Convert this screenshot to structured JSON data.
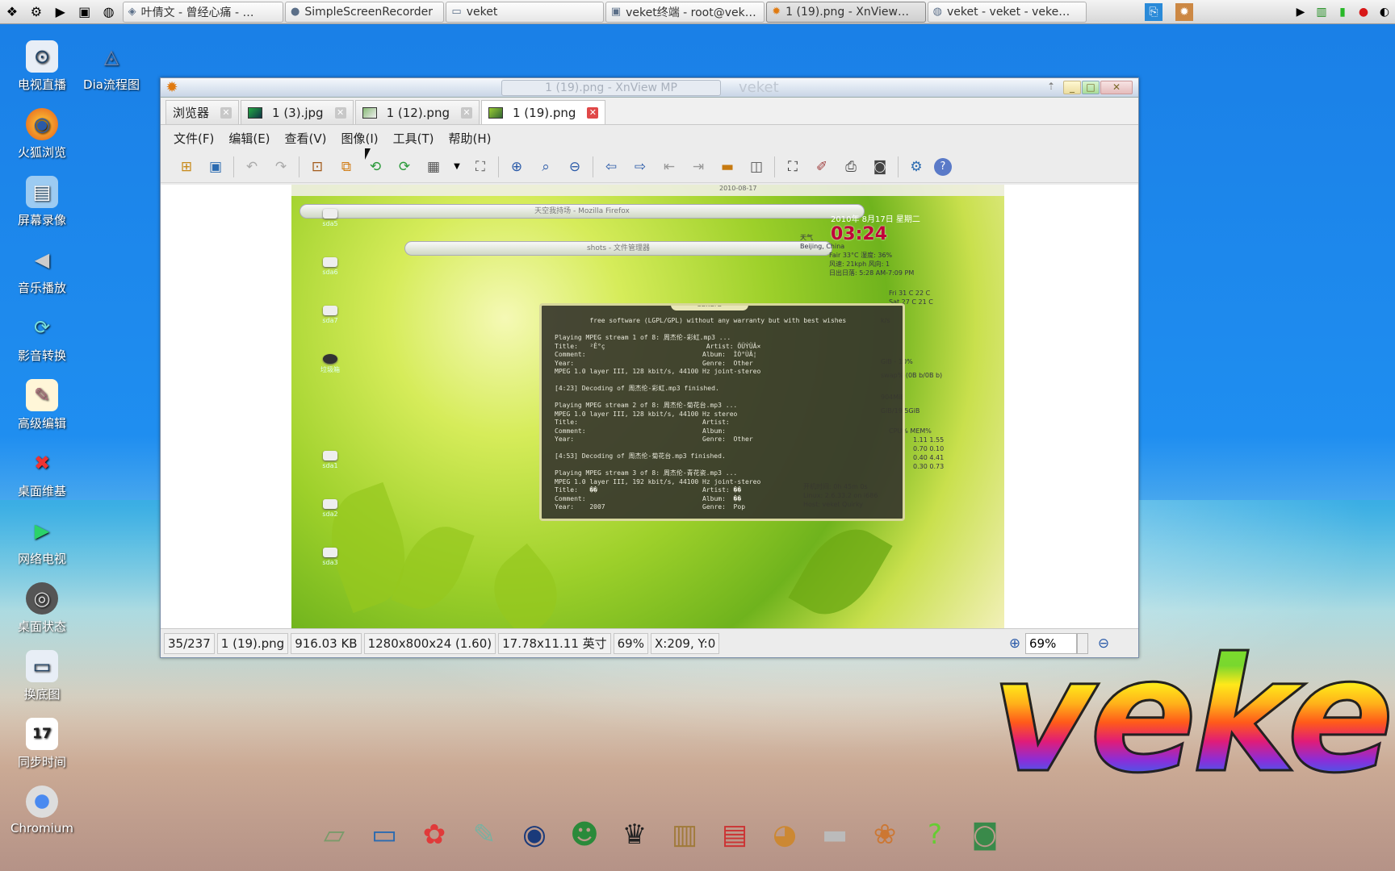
{
  "taskbar": {
    "tasks": [
      {
        "label": "叶倩文 - 曾经心痛 - …",
        "icon": "music-player-icon",
        "active": false
      },
      {
        "label": "SimpleScreenRecorder",
        "icon": "screen-recorder-icon",
        "active": false
      },
      {
        "label": "veket",
        "icon": "folder-icon",
        "active": false
      },
      {
        "label": "veket终端 - root@vek…",
        "icon": "terminal-icon",
        "active": false
      },
      {
        "label": "1 (19).png - XnView…",
        "icon": "xnview-icon",
        "active": true
      },
      {
        "label": "veket - veket - veke…",
        "icon": "browser-icon",
        "active": false
      }
    ]
  },
  "desktop": {
    "icons": [
      {
        "label": "电视直播",
        "icon": "tv-icon"
      },
      {
        "label": "Dia流程图",
        "icon": "dia-icon"
      },
      {
        "label": "火狐浏览",
        "icon": "firefox-icon"
      },
      {
        "label": "屏幕录像",
        "icon": "screen-record-icon"
      },
      {
        "label": "音乐播放",
        "icon": "speaker-icon"
      },
      {
        "label": "影音转换",
        "icon": "media-convert-icon"
      },
      {
        "label": "高级编辑",
        "icon": "editor-icon"
      },
      {
        "label": "桌面维基",
        "icon": "wiki-icon"
      },
      {
        "label": "网络电视",
        "icon": "play-icon"
      },
      {
        "label": "桌面状态",
        "icon": "status-icon"
      },
      {
        "label": "换底图",
        "icon": "wallpaper-icon"
      },
      {
        "label": "同步时间",
        "icon": "calendar-icon"
      },
      {
        "label": "Chromium",
        "icon": "chromium-icon"
      }
    ],
    "calendar_day": "17",
    "logo_text": "veke"
  },
  "window": {
    "title": "1 (19).png - XnView MP",
    "name": "veket",
    "tabs": [
      {
        "label": "浏览器",
        "active": false
      },
      {
        "label": "1 (3).jpg",
        "active": false
      },
      {
        "label": "1 (12).png",
        "active": false
      },
      {
        "label": "1 (19).png",
        "active": true
      }
    ],
    "menu": [
      "文件(F)",
      "编辑(E)",
      "查看(V)",
      "图像(I)",
      "工具(T)",
      "帮助(H)"
    ],
    "status": {
      "index": "35/237",
      "filename": "1 (19).png",
      "filesize": "916.03 KB",
      "dimensions": "1280x800x24 (1.60)",
      "print_size": "17.78x11.11 英寸",
      "zoom": "69%",
      "coords": "X:209, Y:0",
      "zoom_input": "69%"
    }
  },
  "image": {
    "firefox_bar": "天空我持场 - Mozilla Firefox",
    "shots_bar": "shots - 文件管理器",
    "top_date": "2010-08-17",
    "clock_date": "2010年 8月17日 星期二",
    "clock_time": "03:24",
    "terminal_title": "sakura",
    "terminal_text": "         free software (LGPL/GPL) without any warranty but with best wishes\n\nPlaying MPEG stream 1 of 8: 周杰伦-彩虹.mp3 ...\nTitle:   ²Ê°ç                          Artist: ÖÜÝÜÂ×\nComment:                              Album:  ÌÒ°ÙÂ¦\nYear:                                 Genre:  Other\nMPEG 1.0 layer III, 128 kbit/s, 44100 Hz joint-stereo\n\n[4:23] Decoding of 周杰伦-彩虹.mp3 finished.\n\nPlaying MPEG stream 2 of 8: 周杰伦-菊花台.mp3 ...\nMPEG 1.0 layer III, 128 kbit/s, 44100 Hz stereo\nTitle:                                Artist:\nComment:                              Album:\nYear:                                 Genre:  Other\n\n[4:53] Decoding of 周杰伦-菊花台.mp3 finished.\n\nPlaying MPEG stream 3 of 8: 周杰伦-青花瓷.mp3 ...\nMPEG 1.0 layer III, 192 kbit/s, 44100 Hz joint-stereo\nTitle:   ��                           Artist: ��\nComment:                              Album:  ��\nYear:    2007                         Genre:  Pop",
    "weather_label": "天气",
    "weather_city": "Beijing, China",
    "weather_info": "Fair  33°C 湿度: 36%",
    "weather_wind": "风速: 21kph 风向: 1",
    "weather_sun": "日出日落: 5:28 AM-7:09 PM",
    "forecast": [
      "Fri 31 C 22 C",
      "Sat 27 C 21 C"
    ],
    "drives": [
      "sda5",
      "sda6",
      "sda7",
      "垃圾箱",
      "sda1",
      "sda2",
      "sda3"
    ],
    "sys_lines": [
      "k/s",
      "GiB - 10%",
      "swap% (0B b/0B b)",
      "904MiB",
      "GiB/19.5GiB",
      "CPU%   MEM%"
    ],
    "cpu_rows": [
      "1.11  1.55",
      "0.70  0.10",
      "0.40  4.41",
      "0.30  0.73"
    ],
    "uptime_lines": [
      "开机时间: 0h 45m 0s",
      "Linux: 2.6.33.2 on i686",
      "Host: veket Quirky"
    ]
  }
}
